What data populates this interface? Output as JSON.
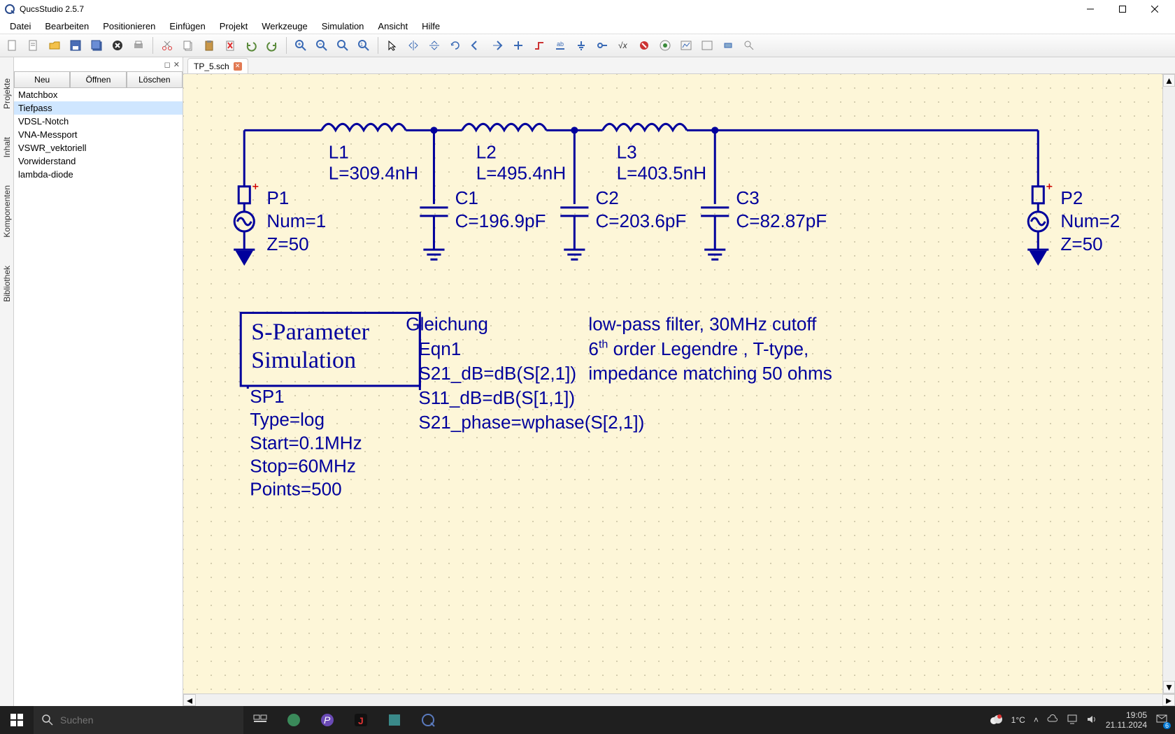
{
  "title": "QucsStudio 2.5.7",
  "menu": {
    "items": [
      "Datei",
      "Bearbeiten",
      "Positionieren",
      "Einfügen",
      "Projekt",
      "Werkzeuge",
      "Simulation",
      "Ansicht",
      "Hilfe"
    ]
  },
  "panel_buttons": {
    "neu": "Neu",
    "oeffnen": "Öffnen",
    "loeschen": "Löschen"
  },
  "side_tabs": [
    "Projekte",
    "Inhalt",
    "Komponenten",
    "Bibliothek"
  ],
  "projects": {
    "items": [
      "Matchbox",
      "Tiefpass",
      "VDSL-Notch",
      "VNA-Messport",
      "VSWR_vektoriell",
      "Vorwiderstand",
      "lambda-diode"
    ],
    "selected_index": 1
  },
  "tab": {
    "label": "TP_5.sch"
  },
  "schematic": {
    "p1": {
      "name": "P1",
      "num": "Num=1",
      "z": "Z=50"
    },
    "p2": {
      "name": "P2",
      "num": "Num=2",
      "z": "Z=50"
    },
    "l1": {
      "name": "L1",
      "val": "L=309.4nH"
    },
    "l2": {
      "name": "L2",
      "val": "L=495.4nH"
    },
    "l3": {
      "name": "L3",
      "val": "L=403.5nH"
    },
    "c1": {
      "name": "C1",
      "val": "C=196.9pF"
    },
    "c2": {
      "name": "C2",
      "val": "C=203.6pF"
    },
    "c3": {
      "name": "C3",
      "val": "C=82.87pF"
    },
    "sim": {
      "title1": "S-Parameter",
      "title2": "Simulation",
      "name": "SP1",
      "type": "Type=log",
      "start": "Start=0.1MHz",
      "stop": "Stop=60MHz",
      "points": "Points=500"
    },
    "eqn": {
      "title": "Gleichung",
      "name": "Eqn1",
      "e1": "S21_dB=dB(S[2,1])",
      "e2": "S11_dB=dB(S[1,1])",
      "e3": "S21_phase=wphase(S[2,1])"
    },
    "note": {
      "l1": "low-pass filter, 30MHz cutoff",
      "l2a": "6",
      "l2sup": "th",
      "l2b": " order Legendre , T-type,",
      "l3": "impedance matching 50 ohms"
    }
  },
  "taskbar": {
    "search_placeholder": "Suchen",
    "weather": "1°C",
    "time": "19:05",
    "date": "21.11.2024",
    "notif": "6"
  }
}
